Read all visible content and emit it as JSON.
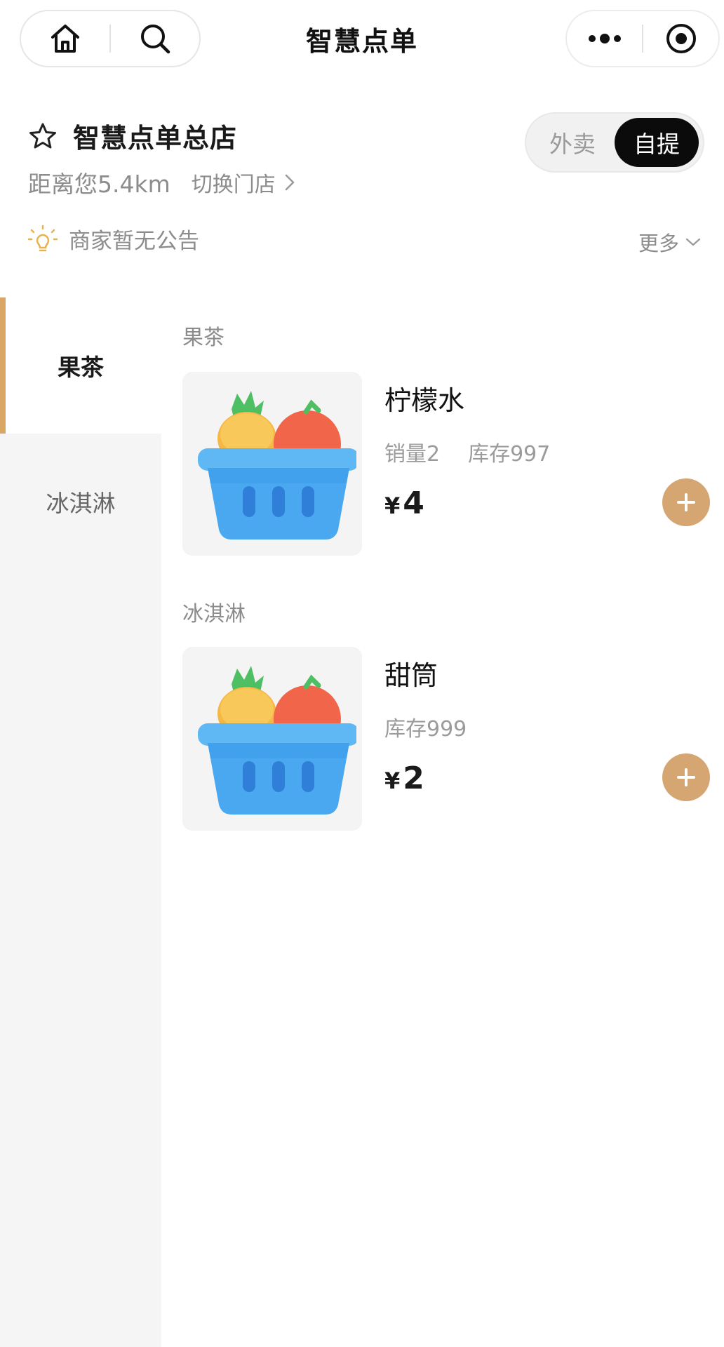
{
  "nav": {
    "title": "智慧点单",
    "left_icons": [
      "home-icon",
      "search-icon"
    ],
    "right_icons": [
      "more-dots-icon",
      "close-target-icon"
    ]
  },
  "store": {
    "name": "智慧点单总店",
    "distance": "距离您5.4km",
    "switch_label": "切换门店",
    "mode_options": [
      "外卖",
      "自提"
    ],
    "mode_selected": "自提"
  },
  "notice": {
    "text": "商家暂无公告",
    "more_label": "更多"
  },
  "categories": [
    {
      "label": "果茶",
      "active": true
    },
    {
      "label": "冰淇淋",
      "active": false
    }
  ],
  "sections": [
    {
      "title": "果茶",
      "products": [
        {
          "name": "柠檬水",
          "sales": "销量2",
          "stock": "库存997",
          "currency": "¥",
          "price": "4",
          "image": "fruit-basket-icon"
        }
      ]
    },
    {
      "title": "冰淇淋",
      "products": [
        {
          "name": "甜筒",
          "sales": "",
          "stock": "库存999",
          "currency": "¥",
          "price": "2",
          "image": "fruit-basket-icon"
        }
      ]
    }
  ],
  "colors": {
    "accent": "#d5a671",
    "sidebar_indicator": "#d9a665",
    "toggle_active_bg": "#0b0b0b",
    "sidebar_bg": "#f5f5f5"
  }
}
